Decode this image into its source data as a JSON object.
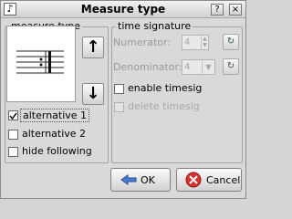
{
  "window": {
    "title": "Measure type",
    "icon_name": "music-note-app-icon"
  },
  "titlebar_buttons": {
    "help": "?",
    "close": "×"
  },
  "measure_type": {
    "group_label": "measure type",
    "up_button_icon": "↑",
    "down_button_icon": "↓",
    "checkboxes": [
      {
        "label": "alternative 1",
        "checked": true
      },
      {
        "label": "alternative 2",
        "checked": false
      },
      {
        "label": "hide following",
        "checked": false
      }
    ]
  },
  "time_signature": {
    "group_label": "time signature",
    "numerator_label": "Numerator:",
    "numerator_value": "4",
    "denominator_label": "Denominator:",
    "denominator_value": "4",
    "enable_label": "enable timesig",
    "enable_checked": false,
    "delete_label": "delete timesig",
    "delete_checked": false,
    "delete_enabled": false
  },
  "buttons": {
    "ok_label": "OK",
    "cancel_label": "Cancel"
  },
  "colors": {
    "window_bg": "#d9d9d9",
    "cancel_icon": "#d93030",
    "ok_icon": "#4a7bd0"
  }
}
